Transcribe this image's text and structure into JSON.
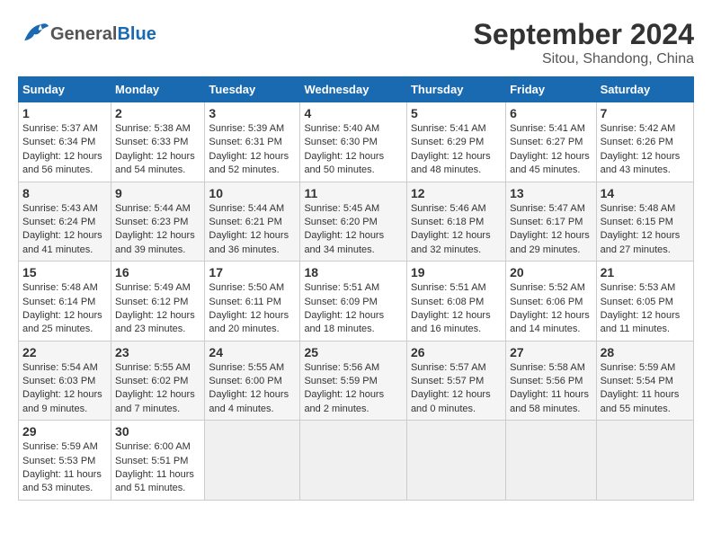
{
  "header": {
    "logo_text_general": "General",
    "logo_text_blue": "Blue",
    "title": "September 2024",
    "subtitle": "Sitou, Shandong, China"
  },
  "calendar": {
    "days_of_week": [
      "Sunday",
      "Monday",
      "Tuesday",
      "Wednesday",
      "Thursday",
      "Friday",
      "Saturday"
    ],
    "weeks": [
      [
        {
          "day": "",
          "empty": true
        },
        {
          "day": "",
          "empty": true
        },
        {
          "day": "",
          "empty": true
        },
        {
          "day": "",
          "empty": true
        },
        {
          "day": "",
          "empty": true
        },
        {
          "day": "",
          "empty": true
        },
        {
          "day": "",
          "empty": true
        }
      ]
    ],
    "rows": [
      [
        {
          "num": "1",
          "sunrise": "5:37 AM",
          "sunset": "6:34 PM",
          "daylight": "12 hours and 56 minutes."
        },
        {
          "num": "2",
          "sunrise": "5:38 AM",
          "sunset": "6:33 PM",
          "daylight": "12 hours and 54 minutes."
        },
        {
          "num": "3",
          "sunrise": "5:39 AM",
          "sunset": "6:31 PM",
          "daylight": "12 hours and 52 minutes."
        },
        {
          "num": "4",
          "sunrise": "5:40 AM",
          "sunset": "6:30 PM",
          "daylight": "12 hours and 50 minutes."
        },
        {
          "num": "5",
          "sunrise": "5:41 AM",
          "sunset": "6:29 PM",
          "daylight": "12 hours and 48 minutes."
        },
        {
          "num": "6",
          "sunrise": "5:41 AM",
          "sunset": "6:27 PM",
          "daylight": "12 hours and 45 minutes."
        },
        {
          "num": "7",
          "sunrise": "5:42 AM",
          "sunset": "6:26 PM",
          "daylight": "12 hours and 43 minutes."
        }
      ],
      [
        {
          "num": "8",
          "sunrise": "5:43 AM",
          "sunset": "6:24 PM",
          "daylight": "12 hours and 41 minutes."
        },
        {
          "num": "9",
          "sunrise": "5:44 AM",
          "sunset": "6:23 PM",
          "daylight": "12 hours and 39 minutes."
        },
        {
          "num": "10",
          "sunrise": "5:44 AM",
          "sunset": "6:21 PM",
          "daylight": "12 hours and 36 minutes."
        },
        {
          "num": "11",
          "sunrise": "5:45 AM",
          "sunset": "6:20 PM",
          "daylight": "12 hours and 34 minutes."
        },
        {
          "num": "12",
          "sunrise": "5:46 AM",
          "sunset": "6:18 PM",
          "daylight": "12 hours and 32 minutes."
        },
        {
          "num": "13",
          "sunrise": "5:47 AM",
          "sunset": "6:17 PM",
          "daylight": "12 hours and 29 minutes."
        },
        {
          "num": "14",
          "sunrise": "5:48 AM",
          "sunset": "6:15 PM",
          "daylight": "12 hours and 27 minutes."
        }
      ],
      [
        {
          "num": "15",
          "sunrise": "5:48 AM",
          "sunset": "6:14 PM",
          "daylight": "12 hours and 25 minutes."
        },
        {
          "num": "16",
          "sunrise": "5:49 AM",
          "sunset": "6:12 PM",
          "daylight": "12 hours and 23 minutes."
        },
        {
          "num": "17",
          "sunrise": "5:50 AM",
          "sunset": "6:11 PM",
          "daylight": "12 hours and 20 minutes."
        },
        {
          "num": "18",
          "sunrise": "5:51 AM",
          "sunset": "6:09 PM",
          "daylight": "12 hours and 18 minutes."
        },
        {
          "num": "19",
          "sunrise": "5:51 AM",
          "sunset": "6:08 PM",
          "daylight": "12 hours and 16 minutes."
        },
        {
          "num": "20",
          "sunrise": "5:52 AM",
          "sunset": "6:06 PM",
          "daylight": "12 hours and 14 minutes."
        },
        {
          "num": "21",
          "sunrise": "5:53 AM",
          "sunset": "6:05 PM",
          "daylight": "12 hours and 11 minutes."
        }
      ],
      [
        {
          "num": "22",
          "sunrise": "5:54 AM",
          "sunset": "6:03 PM",
          "daylight": "12 hours and 9 minutes."
        },
        {
          "num": "23",
          "sunrise": "5:55 AM",
          "sunset": "6:02 PM",
          "daylight": "12 hours and 7 minutes."
        },
        {
          "num": "24",
          "sunrise": "5:55 AM",
          "sunset": "6:00 PM",
          "daylight": "12 hours and 4 minutes."
        },
        {
          "num": "25",
          "sunrise": "5:56 AM",
          "sunset": "5:59 PM",
          "daylight": "12 hours and 2 minutes."
        },
        {
          "num": "26",
          "sunrise": "5:57 AM",
          "sunset": "5:57 PM",
          "daylight": "12 hours and 0 minutes."
        },
        {
          "num": "27",
          "sunrise": "5:58 AM",
          "sunset": "5:56 PM",
          "daylight": "11 hours and 58 minutes."
        },
        {
          "num": "28",
          "sunrise": "5:59 AM",
          "sunset": "5:54 PM",
          "daylight": "11 hours and 55 minutes."
        }
      ],
      [
        {
          "num": "29",
          "sunrise": "5:59 AM",
          "sunset": "5:53 PM",
          "daylight": "11 hours and 53 minutes."
        },
        {
          "num": "30",
          "sunrise": "6:00 AM",
          "sunset": "5:51 PM",
          "daylight": "11 hours and 51 minutes."
        },
        {
          "num": "",
          "empty": true
        },
        {
          "num": "",
          "empty": true
        },
        {
          "num": "",
          "empty": true
        },
        {
          "num": "",
          "empty": true
        },
        {
          "num": "",
          "empty": true
        }
      ]
    ]
  }
}
